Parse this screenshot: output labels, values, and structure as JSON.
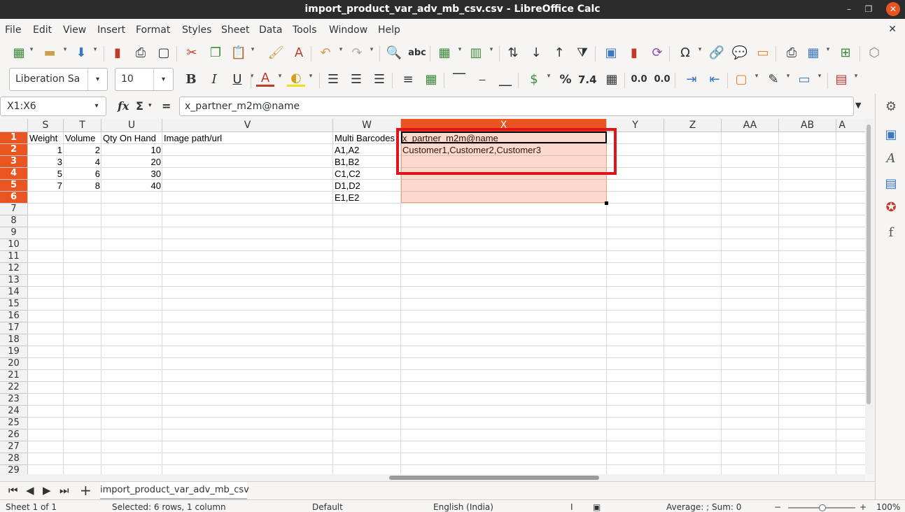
{
  "window": {
    "title": "import_product_var_adv_mb_csv.csv - LibreOffice Calc",
    "minimize": "–",
    "maximize": "❐",
    "close": "✕"
  },
  "menu": [
    "File",
    "Edit",
    "View",
    "Insert",
    "Format",
    "Styles",
    "Sheet",
    "Data",
    "Tools",
    "Window",
    "Help"
  ],
  "menu_close": "✕",
  "toolbar": {
    "font_name": "Liberation Sa",
    "font_size": "10",
    "bold": "B",
    "italic": "I",
    "underline": "U",
    "percent": "%",
    "number": "7.4",
    "dec_add": "0.0",
    "dec_del": "0.0"
  },
  "formula_bar": {
    "name_box": "X1:X6",
    "fx": "fx",
    "sigma": "Σ",
    "equals": "=",
    "content": "x_partner_m2m@name"
  },
  "columns": [
    "S",
    "T",
    "U",
    "V",
    "W",
    "X",
    "Y",
    "Z",
    "AA",
    "AB",
    "A"
  ],
  "rows": [
    "1",
    "2",
    "3",
    "4",
    "5",
    "6",
    "7",
    "8",
    "9",
    "10",
    "11",
    "12",
    "13",
    "14",
    "15",
    "16",
    "17",
    "18",
    "19",
    "20",
    "21",
    "22",
    "23",
    "24",
    "25",
    "26",
    "27",
    "28",
    "29"
  ],
  "cells": {
    "S1": "Weight",
    "T1": "Volume",
    "U1": "Qty On Hand",
    "V1": "Image path/url",
    "W1": "Multi Barcodes",
    "X1": "x_partner_m2m@name",
    "S2": "1",
    "T2": "2",
    "U2": "10",
    "W2": "A1,A2",
    "X2": "Customer1,Customer2,Customer3",
    "S3": "3",
    "T3": "4",
    "U3": "20",
    "W3": "B1,B2",
    "S4": "5",
    "T4": "6",
    "U4": "30",
    "W4": "C1,C2",
    "S5": "7",
    "T5": "8",
    "U5": "40",
    "W5": "D1,D2",
    "W6": "E1,E2"
  },
  "sheet_tab": "import_product_var_adv_mb_csv",
  "status": {
    "sheet": "Sheet 1 of 1",
    "selection": "Selected: 6 rows, 1 column",
    "style": "Default",
    "language": "English (India)",
    "summary": "Average: ; Sum: 0",
    "zoom": "100%",
    "zoom_minus": "−",
    "zoom_plus": "+"
  },
  "colors": {
    "accent": "#e95420",
    "highlight_box": "#e0141b",
    "titlebar": "#2c2c2c"
  }
}
